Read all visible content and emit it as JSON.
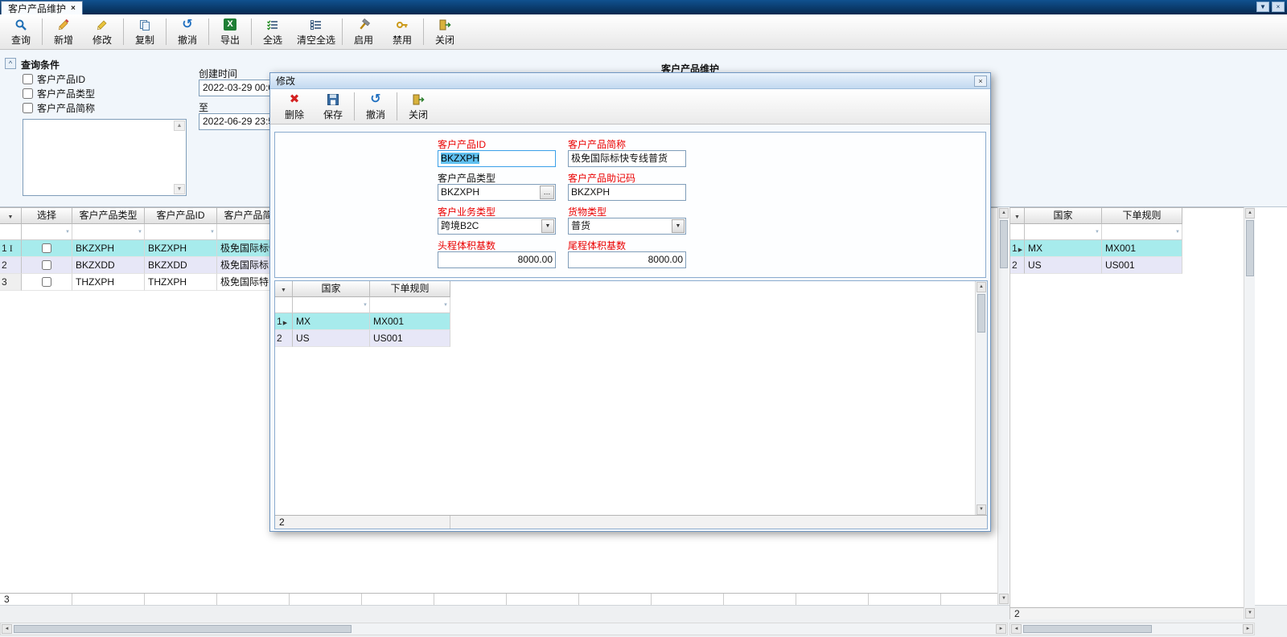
{
  "window": {
    "tab_title": "客户产品维护",
    "tab_close": "×",
    "minimize": "▼",
    "close": "×"
  },
  "toolbar": {
    "buttons": [
      {
        "label": "查询"
      },
      {
        "label": "新增"
      },
      {
        "label": "修改"
      },
      {
        "label": "复制"
      },
      {
        "label": "撤消"
      },
      {
        "label": "导出"
      },
      {
        "label": "全选"
      },
      {
        "label": "清空全选"
      },
      {
        "label": "启用"
      },
      {
        "label": "禁用"
      },
      {
        "label": "关闭"
      }
    ]
  },
  "query": {
    "title": "查询条件",
    "checks": [
      {
        "label": "客户产品ID"
      },
      {
        "label": "客户产品类型"
      },
      {
        "label": "客户产品简称"
      }
    ],
    "created_label": "创建时间",
    "from_value": "2022-03-29 00:0",
    "to_label": "至",
    "to_value": "2022-06-29 23:5",
    "section_title": "客户产品维护"
  },
  "left_grid": {
    "columns": [
      "选择",
      "客户产品类型",
      "客户产品ID",
      "客户产品简称"
    ],
    "rows": [
      {
        "num": "1",
        "type": "BKZXPH",
        "id": "BKZXPH",
        "name": "极免国际标快专线普货"
      },
      {
        "num": "2",
        "type": "BKZXDD",
        "id": "BKZXDD",
        "name": "极免国际标"
      },
      {
        "num": "3",
        "type": "THZXPH",
        "id": "THZXPH",
        "name": "极免国际特"
      }
    ],
    "count": "3"
  },
  "right_grid": {
    "columns": [
      "国家",
      "下单规则"
    ],
    "rows": [
      {
        "num": "1",
        "country": "MX",
        "rule": "MX001"
      },
      {
        "num": "2",
        "country": "US",
        "rule": "US001"
      }
    ],
    "count": "2"
  },
  "modal": {
    "title": "修改",
    "close": "×",
    "toolbar": [
      {
        "label": "删除"
      },
      {
        "label": "保存"
      },
      {
        "label": "撤消"
      },
      {
        "label": "关闭"
      }
    ],
    "fields": {
      "product_id_label": "客户产品ID",
      "product_id_value": "BKZXPH",
      "product_name_label": "客户产品简称",
      "product_name_value": "极免国际标快专线普货",
      "product_type_label": "客户产品类型",
      "product_type_value": "BKZXPH",
      "browse_glyph": "…",
      "mnemonic_label": "客户产品助记码",
      "mnemonic_value": "BKZXPH",
      "business_type_label": "客户业务类型",
      "business_type_value": "跨境B2C",
      "cargo_type_label": "货物类型",
      "cargo_type_value": "普货",
      "first_leg_label": "头程体积基数",
      "first_leg_value": "8000.00",
      "last_leg_label": "尾程体积基数",
      "last_leg_value": "8000.00"
    },
    "grid": {
      "columns": [
        "国家",
        "下单规则"
      ],
      "rows": [
        {
          "num": "1",
          "country": "MX",
          "rule": "MX001"
        },
        {
          "num": "2",
          "country": "US",
          "rule": "US001"
        }
      ],
      "count": "2"
    }
  }
}
